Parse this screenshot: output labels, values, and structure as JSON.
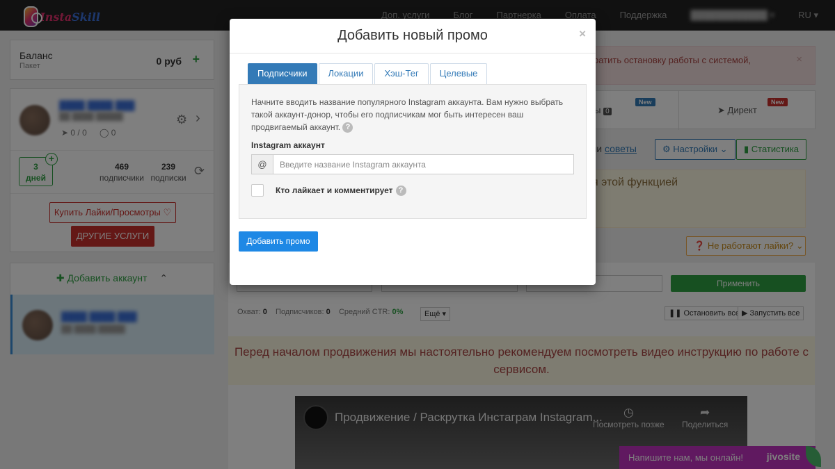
{
  "nav": {
    "logo_text_a": "Insta",
    "logo_text_b": "Skill",
    "links": [
      "Доп. услуги",
      "Блог",
      "Партнерка",
      "Оплата",
      "Поддержка"
    ],
    "language": "RU ▾"
  },
  "sidebar": {
    "balance_label": "Баланс",
    "package_label": "Пакет",
    "balance_amount": "0 руб",
    "likes_count": "0 / 0",
    "comments_count": "0",
    "days_value": "3",
    "days_label": "дней",
    "followers_value": "469",
    "followers_label": "подписчики",
    "following_value": "239",
    "following_label": "подписки",
    "buy_button": "Купить Лайки/Просмотры ♡",
    "other_services_button": "ДРУГИЕ УСЛУГИ",
    "add_account_label": "Добавить аккаунт"
  },
  "background": {
    "alert_text": "ратить остановку работы с системой,",
    "tab_direct": "Директ",
    "tab_new_badge": "New",
    "tab_partial": "нты",
    "tab_partial_count": "0",
    "tips_text": "ши",
    "tips_link": "советы",
    "settings_button": "Настройки",
    "stats_button": "Статистика",
    "yellow_text": "я этой функцией",
    "likes_help_button": "Не работают лайки?",
    "apply_button": "Применить",
    "stats": {
      "reach_label": "Охват:",
      "reach_value": "0",
      "subs_label": "Подписчиков:",
      "subs_value": "0",
      "ctr_label": "Средний CTR:",
      "ctr_value": "0%"
    },
    "more_button": "Ещё ▾",
    "stop_all": "Остановить все",
    "start_all": "Запустить все",
    "recommend_text": "Перед началом продвижения мы настоятельно рекомендуем посмотреть видео инструкцию по работе с сервисом.",
    "video_title": "Продвижение / Раскрутка Инстаграм Instagram...",
    "watch_later": "Посмотреть позже",
    "share": "Поделиться",
    "chat_text": "Напишите нам, мы онлайн!",
    "chat_brand": "jivosite"
  },
  "modal": {
    "title": "Добавить новый промо",
    "close": "×",
    "tabs": [
      "Подписчики",
      "Локации",
      "Хэш-Тег",
      "Целевые"
    ],
    "active_tab": "Подписчики",
    "description": "Начните вводить название популярного Instagram аккаунта. Вам нужно выбрать такой аккаунт-донор, чтобы его подписчикам мог быть интересен ваш продвигаемый аккаунт.",
    "field_label": "Instagram аккаунт",
    "input_addon": "@",
    "input_placeholder": "Введите название Instagram аккаунта",
    "input_value": "",
    "checkbox_label": "Кто лайкает и комментирует",
    "checkbox_checked": false,
    "submit_button": "Добавить промо"
  },
  "colors": {
    "primary": "#1e88e5",
    "tab_active": "#337ab7",
    "green": "#2ea043",
    "red": "#c9302c",
    "chat": "#c032c0"
  }
}
